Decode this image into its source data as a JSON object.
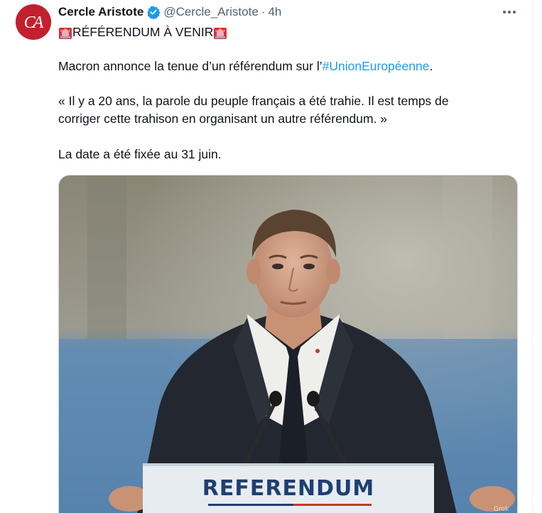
{
  "tweet": {
    "author": {
      "display_name": "Cercle Aristote",
      "handle": "@Cercle_Aristote",
      "avatar_initials": "CA",
      "verified": true
    },
    "separator": "·",
    "time": "4h",
    "headline": "RÉFÉRENDUM À VENIR",
    "body": {
      "line1_prefix": "Macron annonce la tenue d’un référendum sur l’",
      "hashtag": "#UnionEuropéenne",
      "line1_suffix": ".",
      "quote_line1": "« Il y a 20 ans, la parole du peuple français a été trahie. Il est temps de",
      "quote_line2": "corriger cette trahison en organisant un autre référendum. »",
      "date_line": "La date a été fixée au 31 juin."
    },
    "media": {
      "podium_sign": "REFERENDUM",
      "watermark": "Grok"
    }
  },
  "colors": {
    "link": "#1d9bf0",
    "secondary_text": "#536471",
    "avatar_bg": "#c2202f",
    "verified": "#1d9bf0"
  },
  "icons": {
    "verified": "verified-badge-icon",
    "siren": "rotating-light-icon",
    "more": "more-horizontal-icon"
  }
}
